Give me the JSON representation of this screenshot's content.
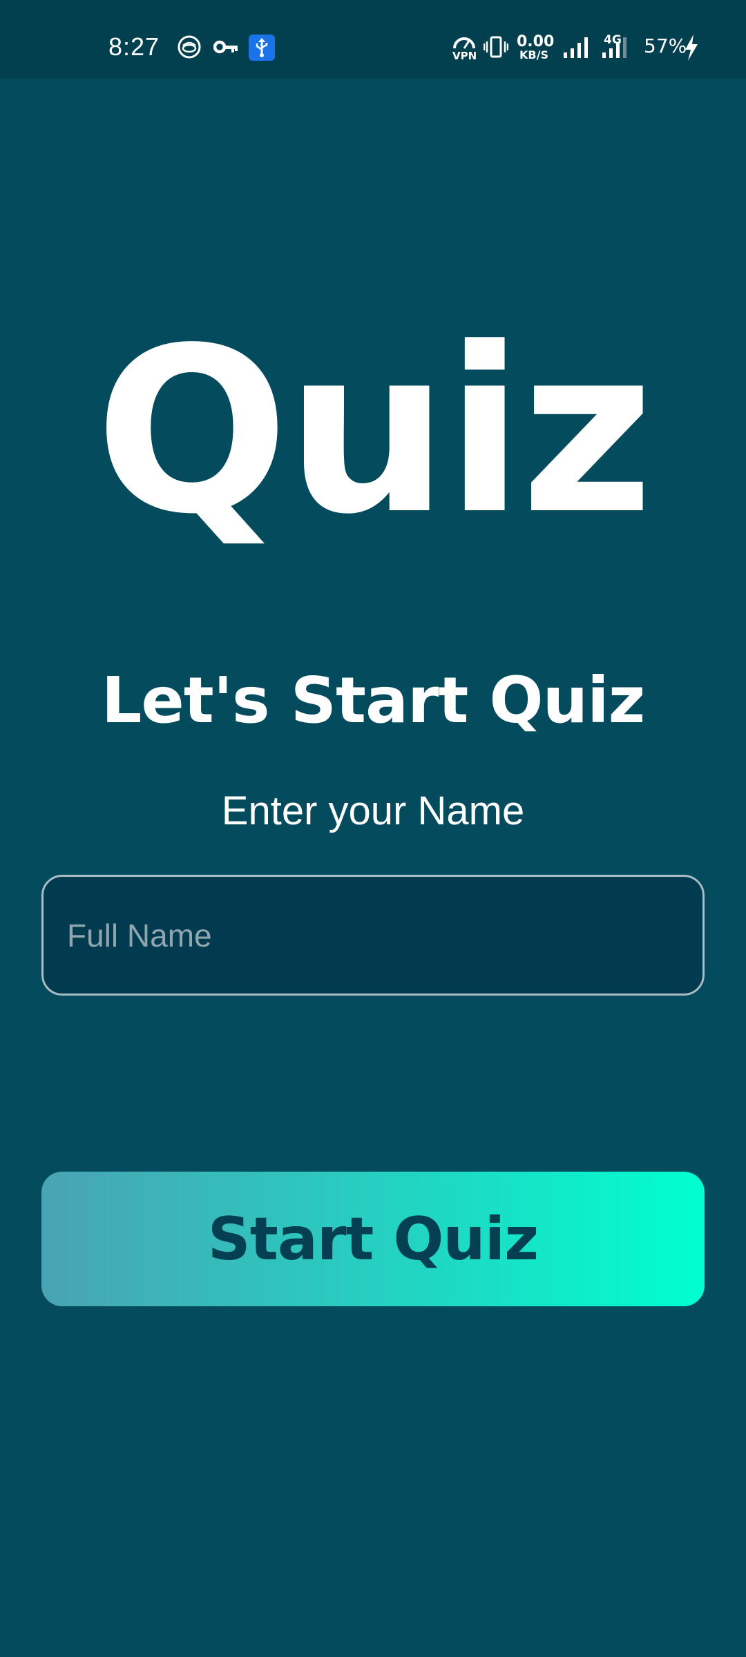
{
  "status_bar": {
    "time": "8:27",
    "left_icons": [
      "browser-icon",
      "key-icon",
      "usb-icon"
    ],
    "vpn_label": "VPN",
    "net_speed_value": "0.00",
    "net_speed_unit": "KB/S",
    "network_type": "4G",
    "battery_percent": "57%",
    "usb_badge_color": "#1a73e8"
  },
  "main": {
    "logo_text": "Quiz",
    "title": "Let's Start Quiz",
    "subtitle": "Enter your Name",
    "name_input": {
      "placeholder": "Full Name",
      "value": ""
    },
    "start_button_label": "Start Quiz"
  },
  "colors": {
    "background": "#044c5d",
    "status_bar": "#03404f",
    "input_background": "#023a4f",
    "input_border": "#a9bcc4",
    "button_gradient_start": "#4aa3b3",
    "button_gradient_end": "#00ffcf",
    "button_text": "#053f52"
  }
}
